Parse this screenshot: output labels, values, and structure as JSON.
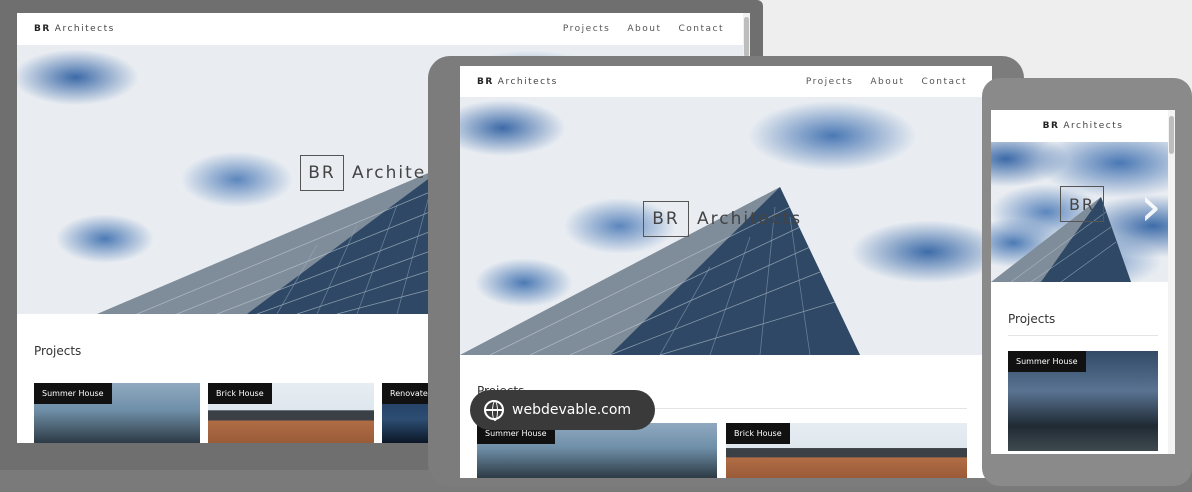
{
  "site": {
    "brand_initials": "BR",
    "brand_name": "Architects",
    "nav": [
      "Projects",
      "About",
      "Contact"
    ],
    "hero_initials": "BR",
    "hero_name": "Architects",
    "hero_name_cropped": "Archite",
    "section_title": "Projects",
    "projects": [
      "Summer House",
      "Brick House",
      "Renovated"
    ],
    "projects_cropped": [
      "Summer House",
      "Brick House",
      "Renovate"
    ]
  },
  "watermark": {
    "text": "webdevable.com",
    "icon": "globe-icon"
  },
  "colors": {
    "frame": "#6f6f6f",
    "tag_bg": "#111111",
    "tag_text": "#ffffff",
    "sky": "#e9edf2",
    "sky_blue": "#3c6aa8"
  }
}
